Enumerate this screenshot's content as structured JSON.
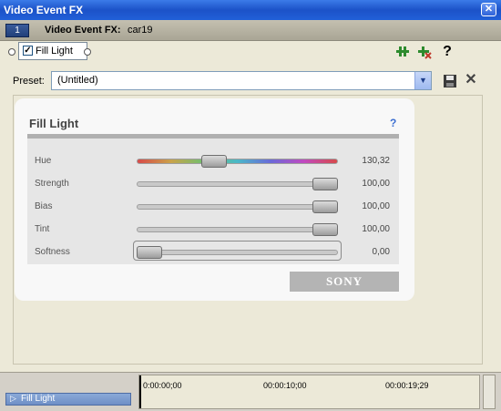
{
  "window": {
    "title": "Video Event FX",
    "close_label": "✕"
  },
  "chain": {
    "number": "1",
    "label": "Video Event FX:",
    "value": "car19"
  },
  "plugin": {
    "name": "Fill Light",
    "checked": "✓"
  },
  "toolbar": {
    "help_label": "?"
  },
  "preset": {
    "label": "Preset:",
    "value": "(Untitled)"
  },
  "panel": {
    "title": "Fill Light",
    "help": "?",
    "logo": "SONY",
    "sliders": [
      {
        "label": "Hue",
        "value": "130,32",
        "level": 0.37
      },
      {
        "label": "Strength",
        "value": "100,00",
        "level": 1.0
      },
      {
        "label": "Bias",
        "value": "100,00",
        "level": 1.0
      },
      {
        "label": "Tint",
        "value": "100,00",
        "level": 1.0
      },
      {
        "label": "Softness",
        "value": "0,00",
        "level": 0.0
      }
    ]
  },
  "bottom": {
    "fx_item": "Fill Light",
    "times": [
      "0:00:00;00",
      "00:00:10;00",
      "00:00:19;29"
    ]
  },
  "colors": {
    "titlebar": "#2160d8",
    "hue_gradient": "linear-gradient(90deg,#d84a4a,#caa24a,#6fc06f,#4ab8c8,#6a6ad8,#c04ac0,#d84a4a)"
  }
}
